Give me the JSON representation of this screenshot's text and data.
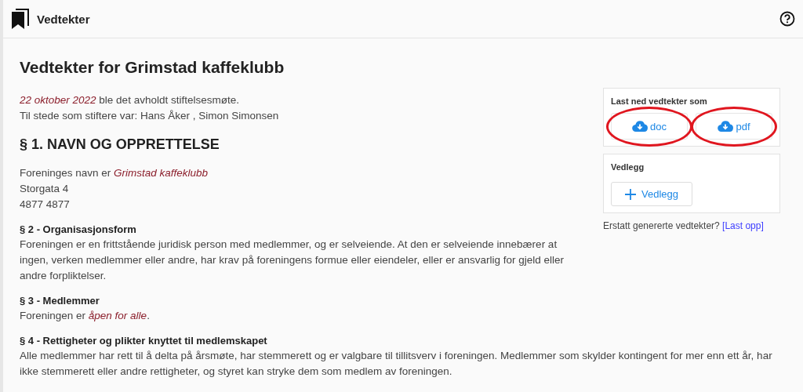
{
  "header": {
    "title": "Vedtekter"
  },
  "document": {
    "title": "Vedtekter for Grimstad kaffeklubb",
    "intro": [
      "*22 oktober 2022* ble det avholdt stiftelsesmøte.",
      "Til stede som stiftere var: Hans Åker , Simon Simonsen"
    ],
    "sections": [
      {
        "kind": "major",
        "heading": "§ 1. NAVN OG OPPRETTELSE",
        "lines": [
          "Foreninges navn er *Grimstad kaffeklubb*",
          "Storgata 4",
          "4877 4877"
        ]
      },
      {
        "kind": "minor",
        "heading": "§ 2 - Organisasjonsform",
        "lines": [
          "Foreningen er en frittstående juridisk person med medlemmer, og er selveiende. At den er selveiende innebærer at ingen, verken medlemmer eller andre, har krav på foreningens formue eller eiendeler, eller er ansvarlig for gjeld eller andre forpliktelser."
        ]
      },
      {
        "kind": "minor",
        "heading": "§ 3 - Medlemmer",
        "lines": [
          "Foreningen er *åpen for alle*."
        ]
      },
      {
        "kind": "minor",
        "heading": "§ 4 - Rettigheter og plikter knyttet til medlemskapet",
        "lines": [
          "Alle medlemmer har rett til å delta på årsmøte, har stemmerett og er valgbare til tillitsverv i foreningen. Medlemmer som skylder kontingent for mer enn ett år, har ikke stemmerett eller andre rettigheter, og styret kan stryke dem som medlem av foreningen."
        ]
      }
    ]
  },
  "panel": {
    "download": {
      "label": "Last ned vedtekter som",
      "buttons": [
        {
          "label": "doc",
          "highlighted": true
        },
        {
          "label": "pdf",
          "highlighted": true
        }
      ]
    },
    "attachments": {
      "label": "Vedlegg",
      "button": "Vedlegg"
    },
    "replace": {
      "text": "Erstatt genererte vedtekter?",
      "link": "[Last opp]"
    }
  }
}
